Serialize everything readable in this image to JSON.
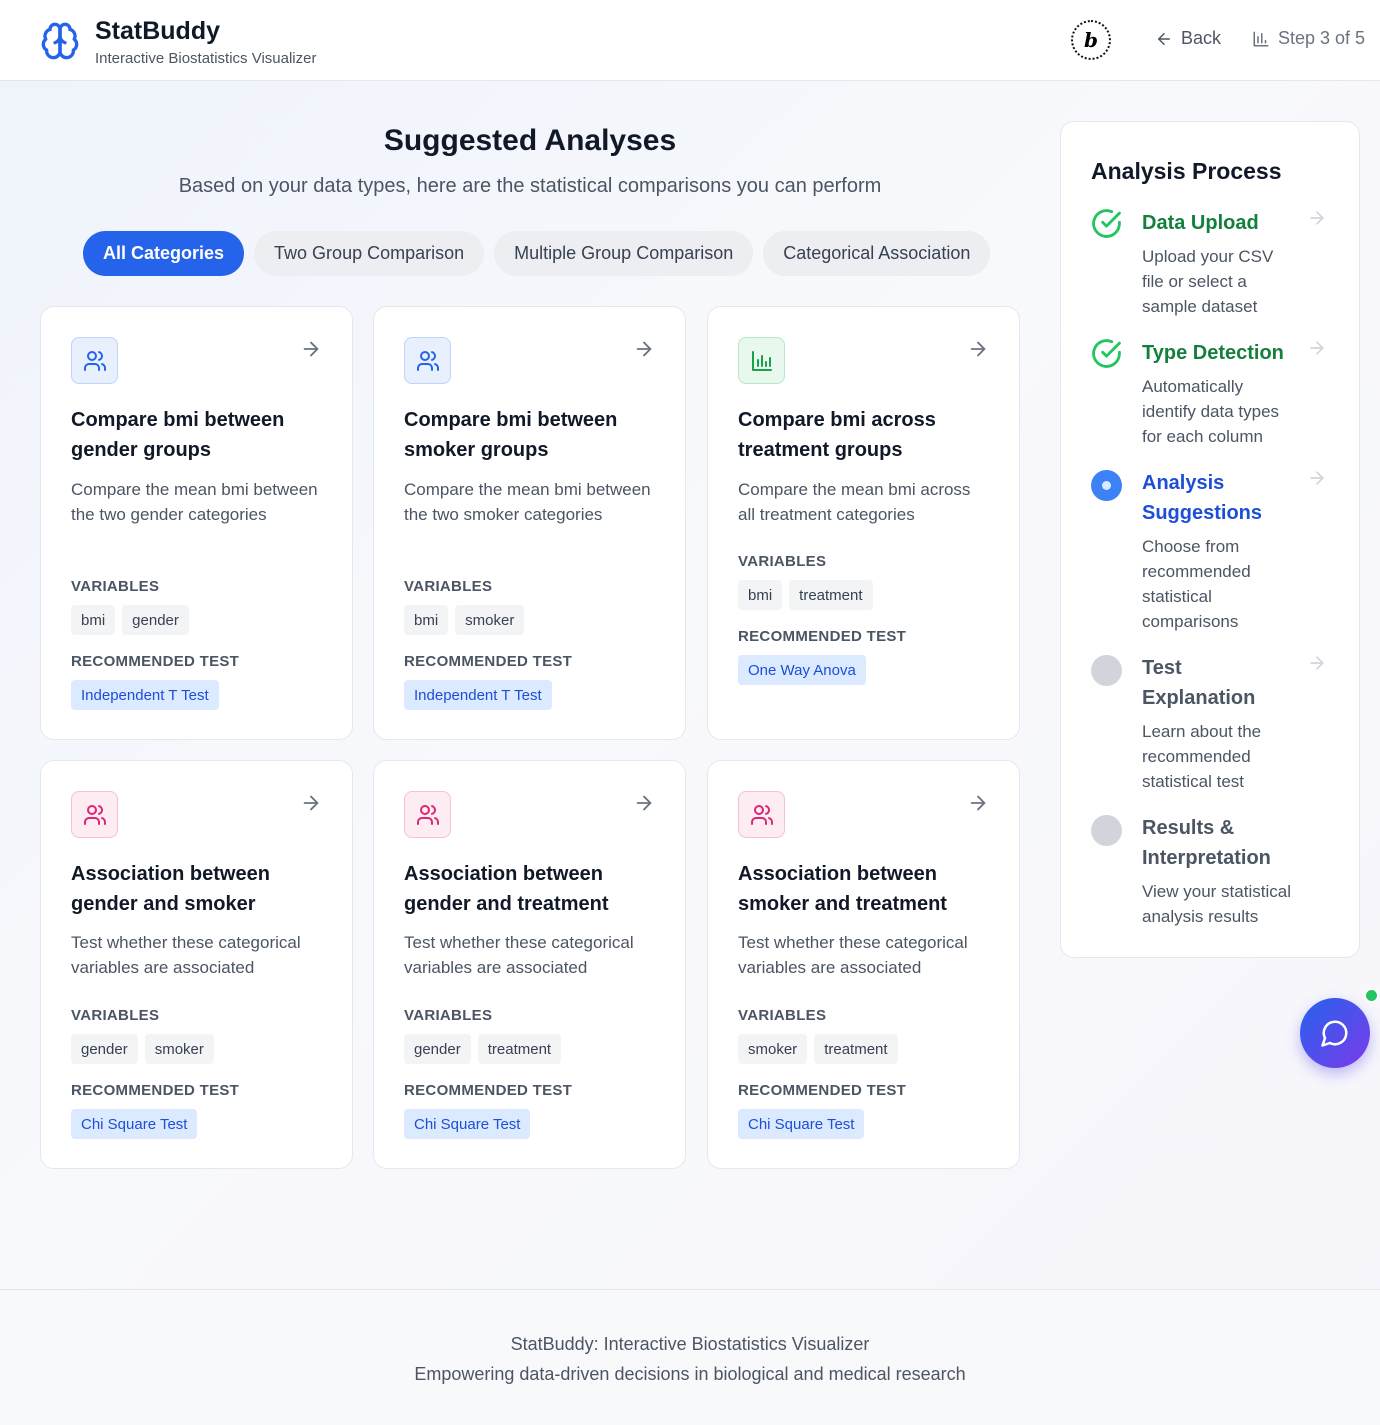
{
  "header": {
    "title": "StatBuddy",
    "subtitle": "Interactive Biostatistics Visualizer",
    "badge_letter": "b",
    "back_label": "Back",
    "step_label": "Step 3 of 5"
  },
  "main": {
    "title": "Suggested Analyses",
    "subtitle": "Based on your data types, here are the statistical comparisons you can perform",
    "filters": [
      "All Categories",
      "Two Group Comparison",
      "Multiple Group Comparison",
      "Categorical Association"
    ],
    "active_filter": "All Categories",
    "variables_label": "VARIABLES",
    "test_label": "RECOMMENDED TEST",
    "cards": [
      {
        "title": "Compare bmi between gender groups",
        "description": "Compare the mean bmi between the two gender categories",
        "variables": [
          "bmi",
          "gender"
        ],
        "test": "Independent T Test",
        "icon": "users-icon",
        "icon_color": "#2563eb"
      },
      {
        "title": "Compare bmi between smoker groups",
        "description": "Compare the mean bmi between the two smoker categories",
        "variables": [
          "bmi",
          "smoker"
        ],
        "test": "Independent T Test",
        "icon": "users-icon",
        "icon_color": "#2563eb"
      },
      {
        "title": "Compare bmi across treatment groups",
        "description": "Compare the mean bmi across all treatment categories",
        "variables": [
          "bmi",
          "treatment"
        ],
        "test": "One Way Anova",
        "icon": "bar-chart-icon",
        "icon_color": "#16a34a"
      },
      {
        "title": "Association between gender and smoker",
        "description": "Test whether these categorical variables are associated",
        "variables": [
          "gender",
          "smoker"
        ],
        "test": "Chi Square Test",
        "icon": "users-icon",
        "icon_color": "#db2777"
      },
      {
        "title": "Association between gender and treatment",
        "description": "Test whether these categorical variables are associated",
        "variables": [
          "gender",
          "treatment"
        ],
        "test": "Chi Square Test",
        "icon": "users-icon",
        "icon_color": "#db2777"
      },
      {
        "title": "Association between smoker and treatment",
        "description": "Test whether these categorical variables are associated",
        "variables": [
          "smoker",
          "treatment"
        ],
        "test": "Chi Square Test",
        "icon": "users-icon",
        "icon_color": "#db2777"
      }
    ]
  },
  "process": {
    "title": "Analysis Process",
    "steps": [
      {
        "title": "Data Upload",
        "description": "Upload your CSV file or select a sample dataset",
        "status": "done"
      },
      {
        "title": "Type Detection",
        "description": "Automatically identify data types for each column",
        "status": "done"
      },
      {
        "title": "Analysis Suggestions",
        "description": "Choose from recommended statistical comparisons",
        "status": "current"
      },
      {
        "title": "Test Explanation",
        "description": "Learn about the recommended statistical test",
        "status": "pending"
      },
      {
        "title": "Results & Interpretation",
        "description": "View your statistical analysis results",
        "status": "pending"
      }
    ]
  },
  "colors": {
    "accent": "#2563eb",
    "done": "#15803d",
    "pending": "#d1d5db"
  },
  "footer": {
    "line1": "StatBuddy: Interactive Biostatistics Visualizer",
    "line2": "Empowering data-driven decisions in biological and medical research"
  }
}
